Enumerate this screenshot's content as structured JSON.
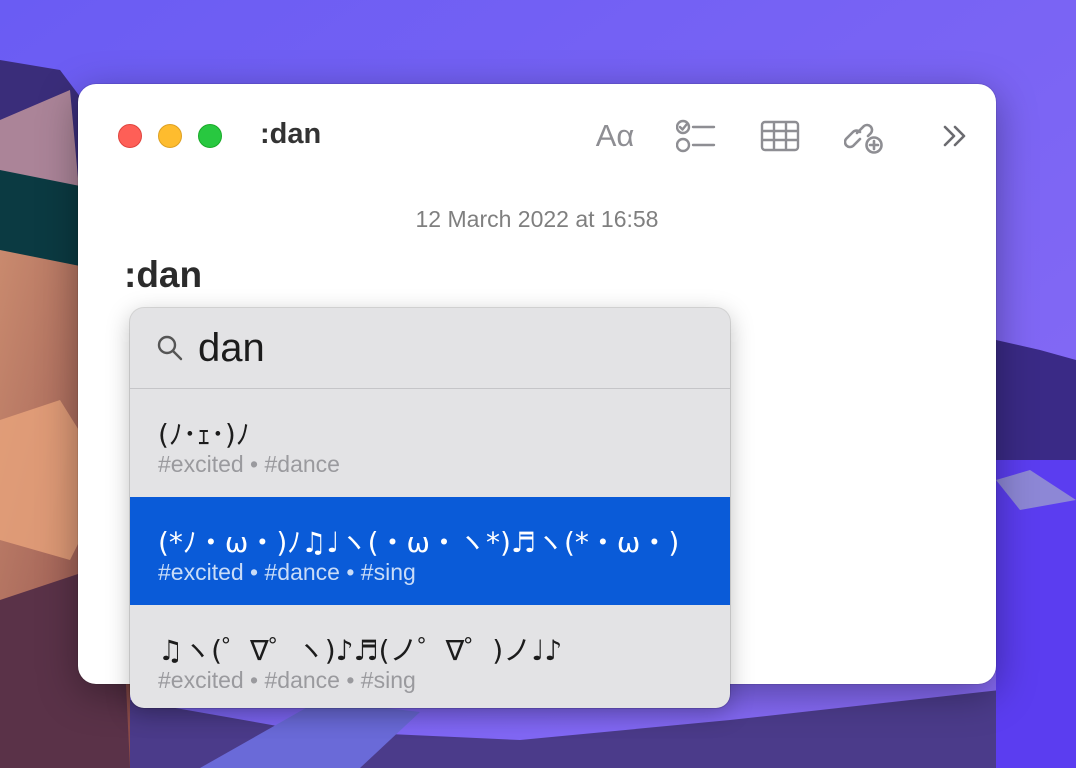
{
  "window": {
    "title": ":dan",
    "toolbar": {
      "format_label": "Aα",
      "icons": [
        "format-icon",
        "checklist-icon",
        "table-icon",
        "link-icon",
        "more-icon"
      ]
    }
  },
  "note": {
    "date": "12 March 2022 at 16:58",
    "heading": ":dan"
  },
  "picker": {
    "search_value": "dan",
    "results": [
      {
        "kaomoji": "(ﾉ･ｪ･)ﾉ",
        "tags": "#excited • #dance",
        "selected": false
      },
      {
        "kaomoji": "(*ﾉ・ω・)ﾉ♫♩ヽ(・ω・ヽ*)♬ヽ(*・ω・)",
        "tags": "#excited • #dance • #sing",
        "selected": true
      },
      {
        "kaomoji": "♫ヽ(゜∇゜ヽ)♪♬(ノ゜∇゜)ノ♩♪",
        "tags": "#excited • #dance • #sing",
        "selected": false
      }
    ]
  },
  "colors": {
    "selection": "#0a5bd8",
    "close": "#fe5f57",
    "minimize": "#febc2e",
    "zoom": "#28c840"
  }
}
